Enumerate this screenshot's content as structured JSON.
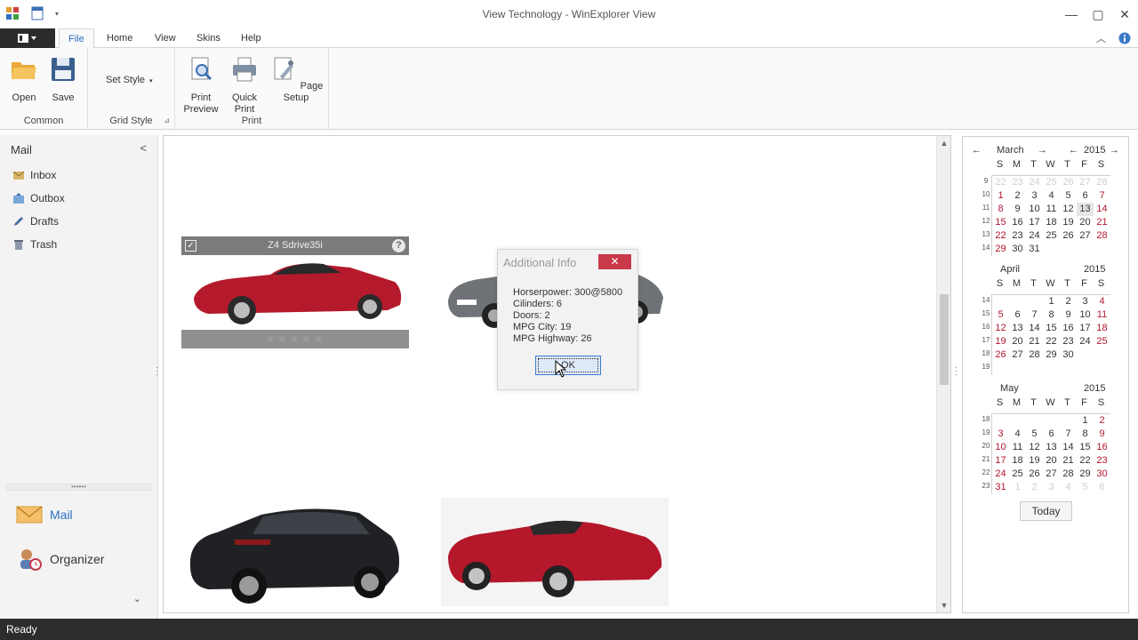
{
  "window": {
    "title": "View Technology - WinExplorer View"
  },
  "tabs": [
    "File",
    "Home",
    "View",
    "Skins",
    "Help"
  ],
  "ribbon": {
    "common": {
      "label": "Common",
      "open": "Open",
      "save": "Save"
    },
    "grid_style": {
      "label": "Grid Style",
      "set_style": "Set Style"
    },
    "print": {
      "label": "Print",
      "print_preview_l1": "Print",
      "print_preview_l2": "Preview",
      "quick_print_l1": "Quick",
      "quick_print_l2": "Print",
      "page_setup": "Page Setup"
    }
  },
  "nav": {
    "header": "Mail",
    "items": [
      "Inbox",
      "Outbox",
      "Drafts",
      "Trash"
    ],
    "big": [
      "Mail",
      "Organizer"
    ],
    "splitter": "••••••"
  },
  "cards": {
    "selected_caption": "Z4 Sdrive35i",
    "help": "?",
    "stars": "★★★★★",
    "rating": 1
  },
  "dialog": {
    "title": "Additional Info",
    "close": "✕",
    "lines": [
      "Horserpower: 300@5800",
      "Cilinders: 6",
      "Doors: 2",
      "MPG City: 19",
      "MPG Highway: 26"
    ],
    "ok": "OK"
  },
  "calendar": {
    "dow": [
      "S",
      "M",
      "T",
      "W",
      "T",
      "F",
      "S"
    ],
    "today_label": "Today",
    "months": [
      {
        "name": "March",
        "year": "2015",
        "weeks": [
          "9",
          "10",
          "11",
          "12",
          "13",
          "14"
        ],
        "rows": [
          [
            "22",
            "23",
            "24",
            "25",
            "26",
            "27",
            "28"
          ],
          [
            "1",
            "2",
            "3",
            "4",
            "5",
            "6",
            "7"
          ],
          [
            "8",
            "9",
            "10",
            "11",
            "12",
            "13",
            "14"
          ],
          [
            "15",
            "16",
            "17",
            "18",
            "19",
            "20",
            "21"
          ],
          [
            "22",
            "23",
            "24",
            "25",
            "26",
            "27",
            "28"
          ],
          [
            "29",
            "30",
            "31",
            "",
            "",
            "",
            ""
          ]
        ]
      },
      {
        "name": "April",
        "year": "2015",
        "weeks": [
          "14",
          "15",
          "16",
          "17",
          "18",
          "19"
        ],
        "rows": [
          [
            "",
            "",
            "",
            "1",
            "2",
            "3",
            "4"
          ],
          [
            "5",
            "6",
            "7",
            "8",
            "9",
            "10",
            "11"
          ],
          [
            "12",
            "13",
            "14",
            "15",
            "16",
            "17",
            "18"
          ],
          [
            "19",
            "20",
            "21",
            "22",
            "23",
            "24",
            "25"
          ],
          [
            "26",
            "27",
            "28",
            "29",
            "30",
            "",
            ""
          ],
          [
            "",
            "",
            "",
            "",
            "",
            "",
            ""
          ]
        ]
      },
      {
        "name": "May",
        "year": "2015",
        "weeks": [
          "18",
          "19",
          "20",
          "21",
          "22",
          "23"
        ],
        "rows": [
          [
            "",
            "",
            "",
            "",
            "",
            "1",
            "2"
          ],
          [
            "3",
            "4",
            "5",
            "6",
            "7",
            "8",
            "9"
          ],
          [
            "10",
            "11",
            "12",
            "13",
            "14",
            "15",
            "16"
          ],
          [
            "17",
            "18",
            "19",
            "20",
            "21",
            "22",
            "23"
          ],
          [
            "24",
            "25",
            "26",
            "27",
            "28",
            "29",
            "30"
          ],
          [
            "31",
            "1",
            "2",
            "3",
            "4",
            "5",
            "6"
          ]
        ]
      }
    ]
  },
  "status": {
    "text": "Ready"
  },
  "colors": {
    "accent": "#2b6fc1",
    "weekend": "#b3162d",
    "close": "#c83a4a",
    "statusbar": "#2d2d2d"
  }
}
